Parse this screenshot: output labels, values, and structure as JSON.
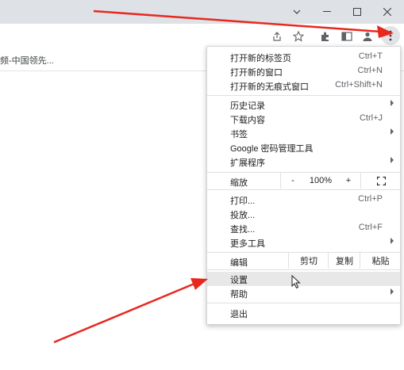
{
  "window": {
    "minimize_icon": "minimize-icon",
    "maximize_icon": "maximize-icon",
    "close_icon": "close-icon",
    "dropdown_icon": "chevron-down-icon"
  },
  "bookmarks": {
    "item": "频-中国领先..."
  },
  "menu": {
    "items": [
      {
        "label": "打开新的标签页",
        "shortcut": "Ctrl+T"
      },
      {
        "label": "打开新的窗口",
        "shortcut": "Ctrl+N"
      },
      {
        "label": "打开新的无痕式窗口",
        "shortcut": "Ctrl+Shift+N"
      },
      {
        "label": "历史记录",
        "submenu": true
      },
      {
        "label": "下载内容",
        "shortcut": "Ctrl+J"
      },
      {
        "label": "书签",
        "submenu": true
      },
      {
        "label": "Google 密码管理工具"
      },
      {
        "label": "扩展程序",
        "submenu": true
      },
      {
        "label": "打印...",
        "shortcut": "Ctrl+P"
      },
      {
        "label": "投放..."
      },
      {
        "label": "查找...",
        "shortcut": "Ctrl+F"
      },
      {
        "label": "更多工具",
        "submenu": true
      },
      {
        "label": "设置"
      },
      {
        "label": "帮助",
        "submenu": true
      },
      {
        "label": "退出"
      }
    ],
    "zoom": {
      "label": "缩放",
      "minus": "-",
      "value": "100%",
      "plus": "+"
    },
    "edit": {
      "label": "编辑",
      "cut": "剪切",
      "copy": "复制",
      "paste": "粘贴"
    }
  },
  "colors": {
    "annotation_arrow": "#e8281f",
    "highlight": "#e8e8e8"
  }
}
